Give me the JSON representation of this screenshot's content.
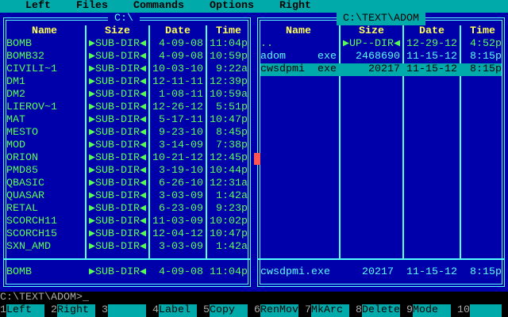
{
  "menu": {
    "left": "Left",
    "files": "Files",
    "commands": "Commands",
    "options": "Options",
    "right": "Right"
  },
  "headers": {
    "name": "Name",
    "size": "Size",
    "date": "Date",
    "time": "Time"
  },
  "left_panel": {
    "path": "C:\\",
    "files": [
      {
        "name": "BOMB",
        "size": "▶SUB-DIR◀",
        "date": "4-09-08",
        "time": "11:04p"
      },
      {
        "name": "BOMB32",
        "size": "▶SUB-DIR◀",
        "date": "4-09-08",
        "time": "10:59p"
      },
      {
        "name": "CIVILI~1",
        "size": "▶SUB-DIR◀",
        "date": "10-03-10",
        "time": "9:22a"
      },
      {
        "name": "DM1",
        "size": "▶SUB-DIR◀",
        "date": "12-11-11",
        "time": "12:39p"
      },
      {
        "name": "DM2",
        "size": "▶SUB-DIR◀",
        "date": "1-08-11",
        "time": "10:59a"
      },
      {
        "name": "LIEROV~1",
        "size": "▶SUB-DIR◀",
        "date": "12-26-12",
        "time": "5:51p"
      },
      {
        "name": "MAT",
        "size": "▶SUB-DIR◀",
        "date": "5-17-11",
        "time": "10:47p"
      },
      {
        "name": "MESTO",
        "size": "▶SUB-DIR◀",
        "date": "9-23-10",
        "time": "8:45p"
      },
      {
        "name": "MOD",
        "size": "▶SUB-DIR◀",
        "date": "3-14-09",
        "time": "7:38p"
      },
      {
        "name": "ORION",
        "size": "▶SUB-DIR◀",
        "date": "10-21-12",
        "time": "12:45p"
      },
      {
        "name": "PMD85",
        "size": "▶SUB-DIR◀",
        "date": "3-19-10",
        "time": "10:44p"
      },
      {
        "name": "QBASIC",
        "size": "▶SUB-DIR◀",
        "date": "6-26-10",
        "time": "12:31a"
      },
      {
        "name": "QUASAR",
        "size": "▶SUB-DIR◀",
        "date": "3-03-09",
        "time": "1:42a"
      },
      {
        "name": "RETAL",
        "size": "▶SUB-DIR◀",
        "date": "6-23-09",
        "time": "9:23p"
      },
      {
        "name": "SCORCH11",
        "size": "▶SUB-DIR◀",
        "date": "11-03-09",
        "time": "10:02p"
      },
      {
        "name": "SCORCH15",
        "size": "▶SUB-DIR◀",
        "date": "12-04-12",
        "time": "10:47p"
      },
      {
        "name": "SXN_AMD",
        "size": "▶SUB-DIR◀",
        "date": "3-03-09",
        "time": "1:42a"
      }
    ],
    "info": {
      "name": "BOMB",
      "size": "▶SUB-DIR◀",
      "date": "4-09-08",
      "time": "11:04p"
    }
  },
  "right_panel": {
    "path": "C:\\TEXT\\ADOM",
    "files": [
      {
        "name": "..",
        "ext": "",
        "size": "▶UP--DIR◀",
        "date": "12-29-12",
        "time": "4:52p",
        "color": "green"
      },
      {
        "name": "adom",
        "ext": "exe",
        "size": "2468690",
        "date": "11-15-12",
        "time": "8:15p",
        "color": "cyan"
      },
      {
        "name": "cwsdpmi",
        "ext": "exe",
        "size": "20217",
        "date": "11-15-12",
        "time": "8:15p",
        "color": "sel"
      }
    ],
    "info": {
      "name": "cwsdpmi.exe",
      "size": "20217",
      "date": "11-15-12",
      "time": "8:15p"
    }
  },
  "command_line": "C:\\TEXT\\ADOM>_",
  "fkeys": [
    {
      "n": "1",
      "l": "Left"
    },
    {
      "n": "2",
      "l": "Right"
    },
    {
      "n": "3",
      "l": ""
    },
    {
      "n": "4",
      "l": "Label"
    },
    {
      "n": "5",
      "l": "Copy"
    },
    {
      "n": "6",
      "l": "RenMov"
    },
    {
      "n": "7",
      "l": "MkArc"
    },
    {
      "n": "8",
      "l": "Delete"
    },
    {
      "n": "9",
      "l": "Mode"
    },
    {
      "n": "10",
      "l": ""
    }
  ]
}
